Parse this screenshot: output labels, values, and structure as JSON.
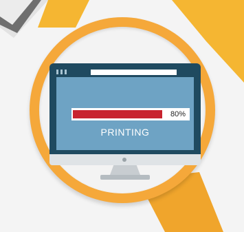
{
  "progress": {
    "percent": 0.8,
    "label": "80%",
    "fill_color": "#c8242f"
  },
  "status": {
    "text": "PRINTING"
  },
  "colors": {
    "ring": "#f5a83a",
    "monitor_bezel": "#1f4a60",
    "screen": "#6ea3c4"
  }
}
